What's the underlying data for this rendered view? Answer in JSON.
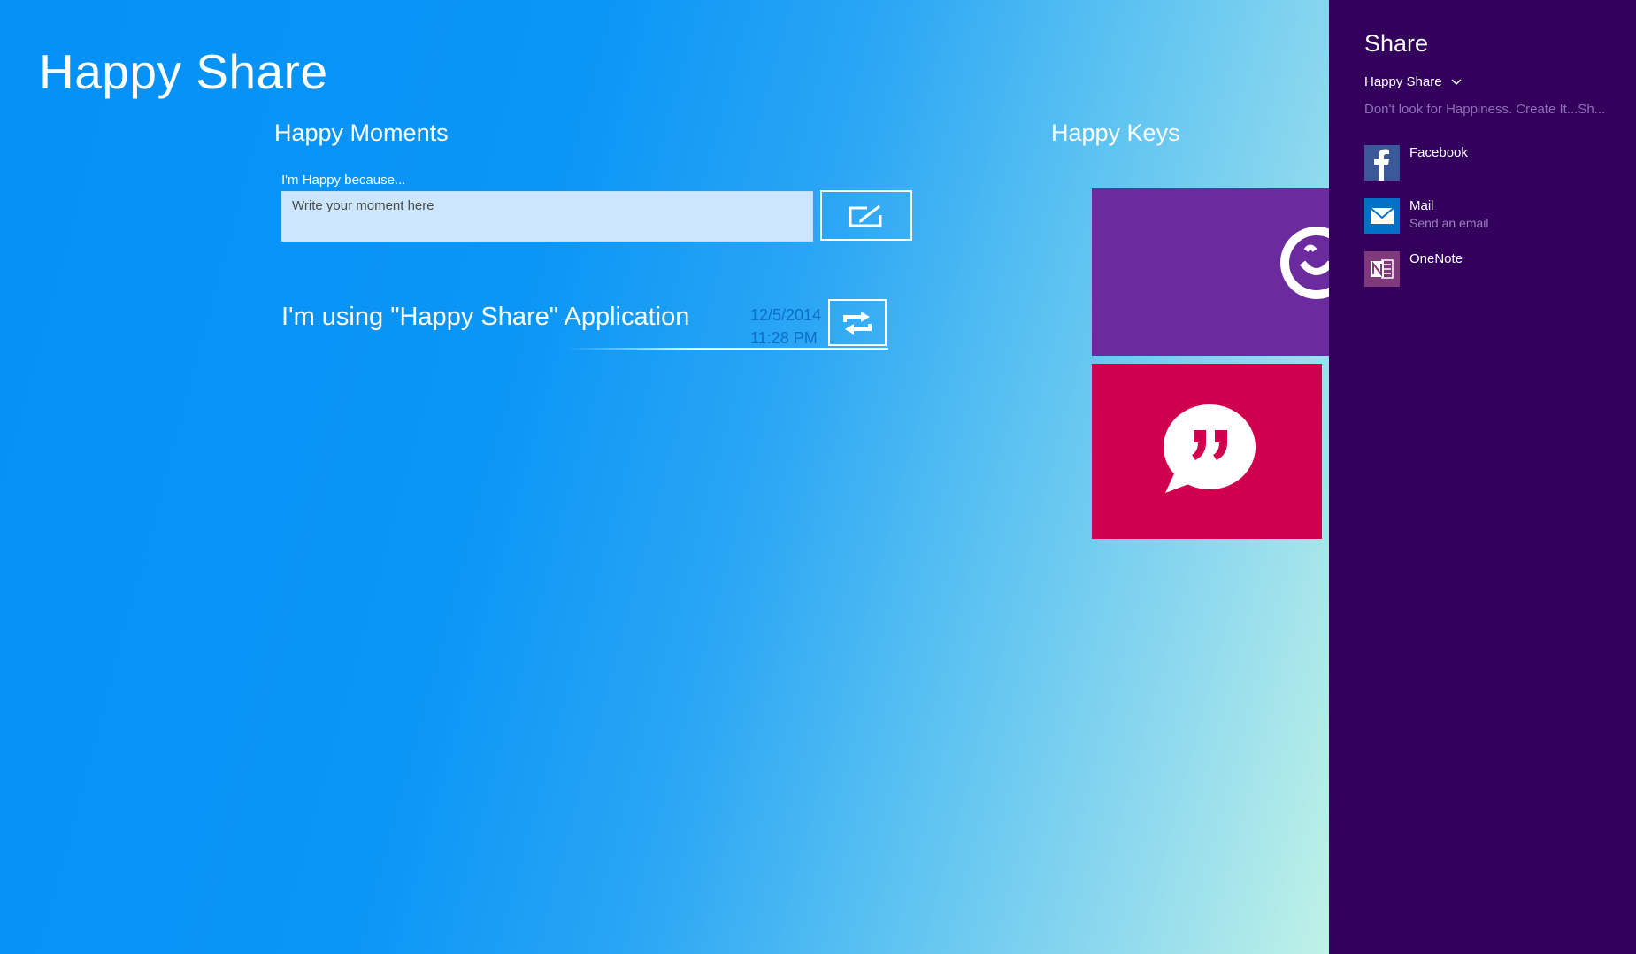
{
  "app": {
    "title": "Happy Share",
    "background_colors": [
      "#0590f6",
      "#2aa6f4",
      "#8ed9ee",
      "#bff2e6"
    ]
  },
  "moments": {
    "section_title": "Happy Moments",
    "input_label": "I'm Happy because...",
    "input_placeholder": "Write your moment here",
    "input_value": "",
    "post_icon": "compose-icon",
    "items": [
      {
        "text": "I'm using \"Happy Share\" Application",
        "date": "12/5/2014",
        "time": "11:28 PM",
        "action_icon": "repost-icon"
      }
    ]
  },
  "keys": {
    "section_title": "Happy Keys",
    "tiles": [
      {
        "icon": "smiley-icon",
        "color": "#6b2b9e"
      },
      {
        "icon": "quote-bubble-icon",
        "color": "#d1004f"
      }
    ]
  },
  "share_panel": {
    "title": "Share",
    "app_name": "Happy Share",
    "app_dropdown_icon": "chevron-down-icon",
    "description": "Don't look for Happiness. Create It...Sh...",
    "background": "#33005c",
    "targets": [
      {
        "name": "Facebook",
        "subtitle": "",
        "icon": "facebook-icon",
        "color": "#3b5998"
      },
      {
        "name": "Mail",
        "subtitle": "Send an email",
        "icon": "mail-icon",
        "color": "#0072c6"
      },
      {
        "name": "OneNote",
        "subtitle": "",
        "icon": "onenote-icon",
        "color": "#80397b"
      }
    ]
  }
}
